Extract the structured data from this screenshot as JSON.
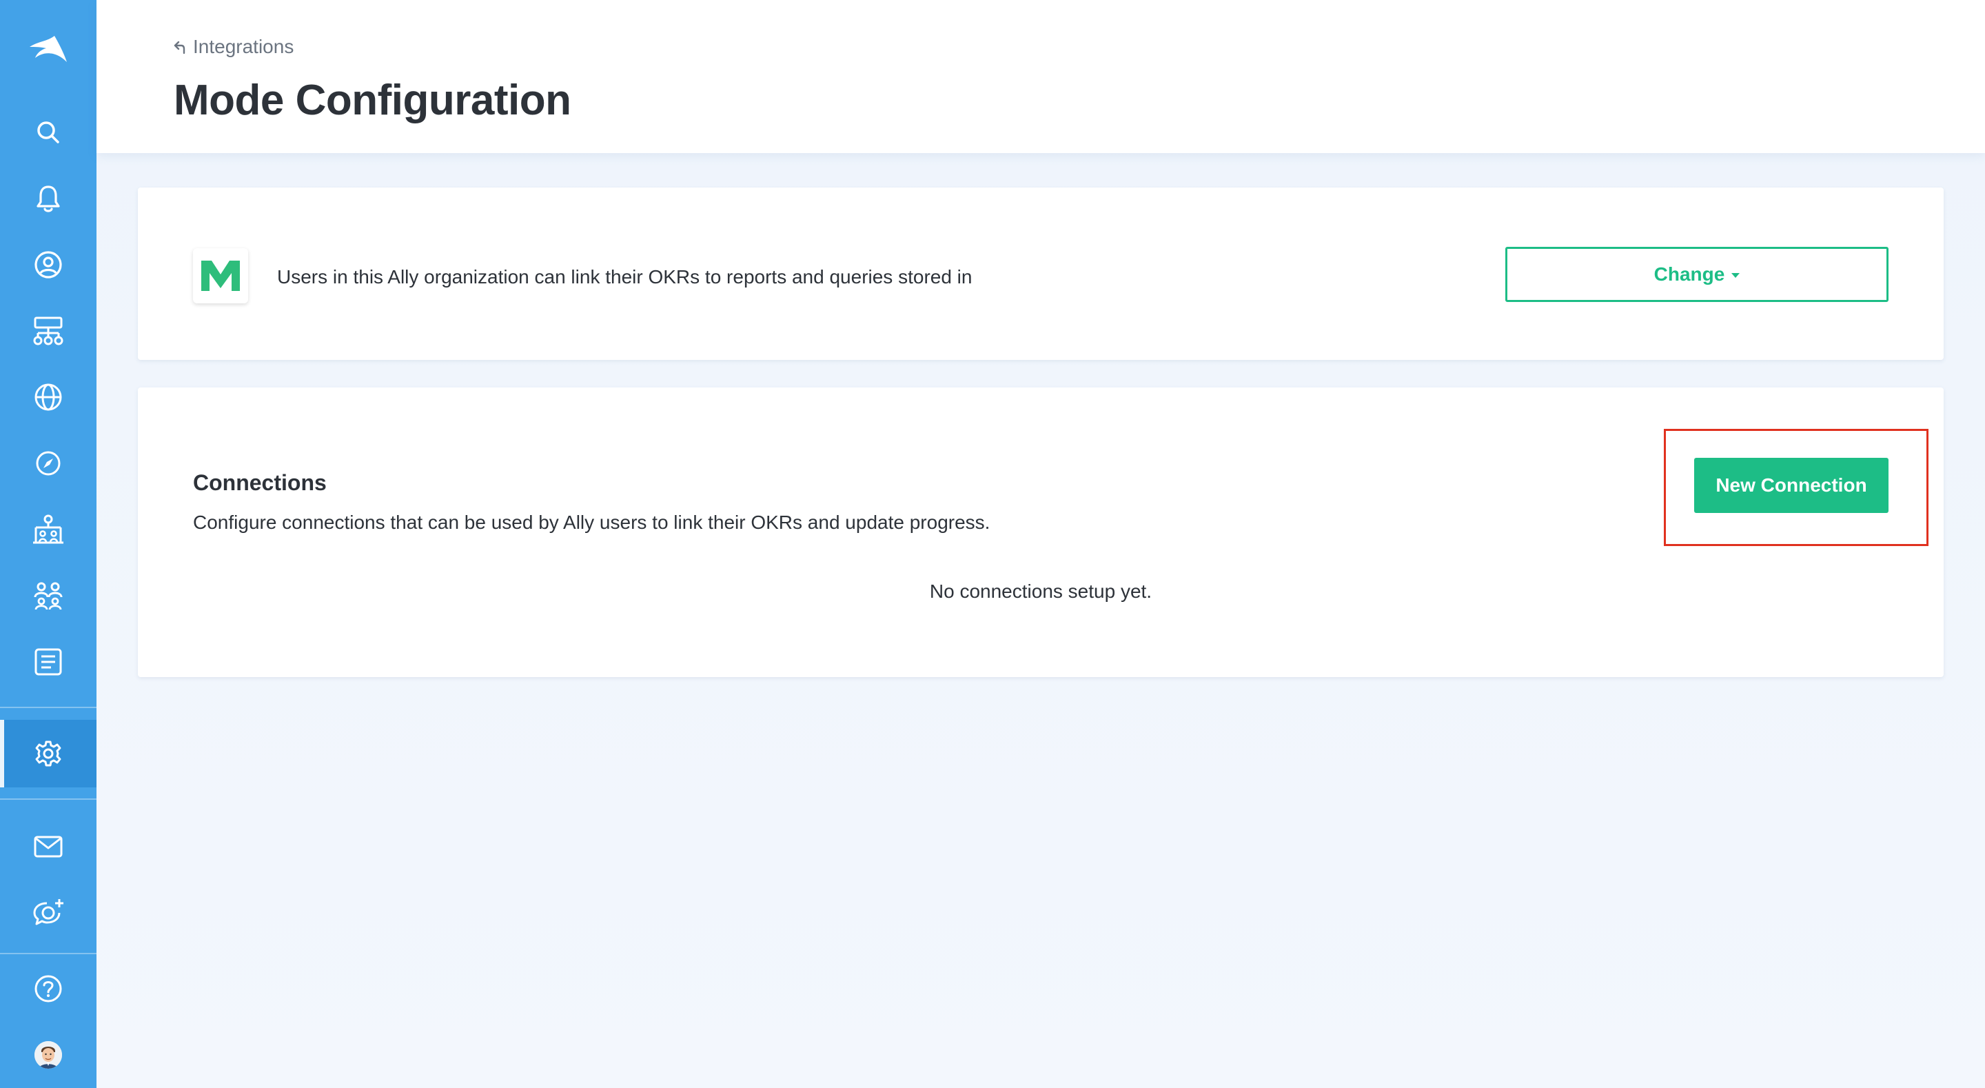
{
  "sidebar": {
    "items": [
      {
        "name": "ally-logo-icon"
      },
      {
        "name": "search-icon"
      },
      {
        "name": "bell-icon"
      },
      {
        "name": "user-circle-icon"
      },
      {
        "name": "org-chart-icon"
      },
      {
        "name": "globe-icon"
      },
      {
        "name": "compass-icon"
      },
      {
        "name": "team-structure-icon"
      },
      {
        "name": "people-icon"
      },
      {
        "name": "document-list-icon"
      },
      {
        "name": "gear-icon",
        "active": true
      },
      {
        "name": "mail-icon"
      },
      {
        "name": "chat-add-icon"
      },
      {
        "name": "help-icon"
      },
      {
        "name": "avatar"
      }
    ]
  },
  "header": {
    "breadcrumb": "Integrations",
    "title": "Mode Configuration"
  },
  "mode_card": {
    "description": "Users in this Ally organization can link their OKRs to reports and queries stored in",
    "change_label": "Change"
  },
  "connections": {
    "title": "Connections",
    "description": "Configure connections that can be used by Ally users to link their OKRs and update progress.",
    "empty_text": "No connections setup yet.",
    "new_button_label": "New Connection"
  },
  "colors": {
    "sidebar": "#43a2e8",
    "accent_green": "#1dbd86",
    "highlight_red": "#e0311f",
    "text_dark": "#2d3239"
  }
}
